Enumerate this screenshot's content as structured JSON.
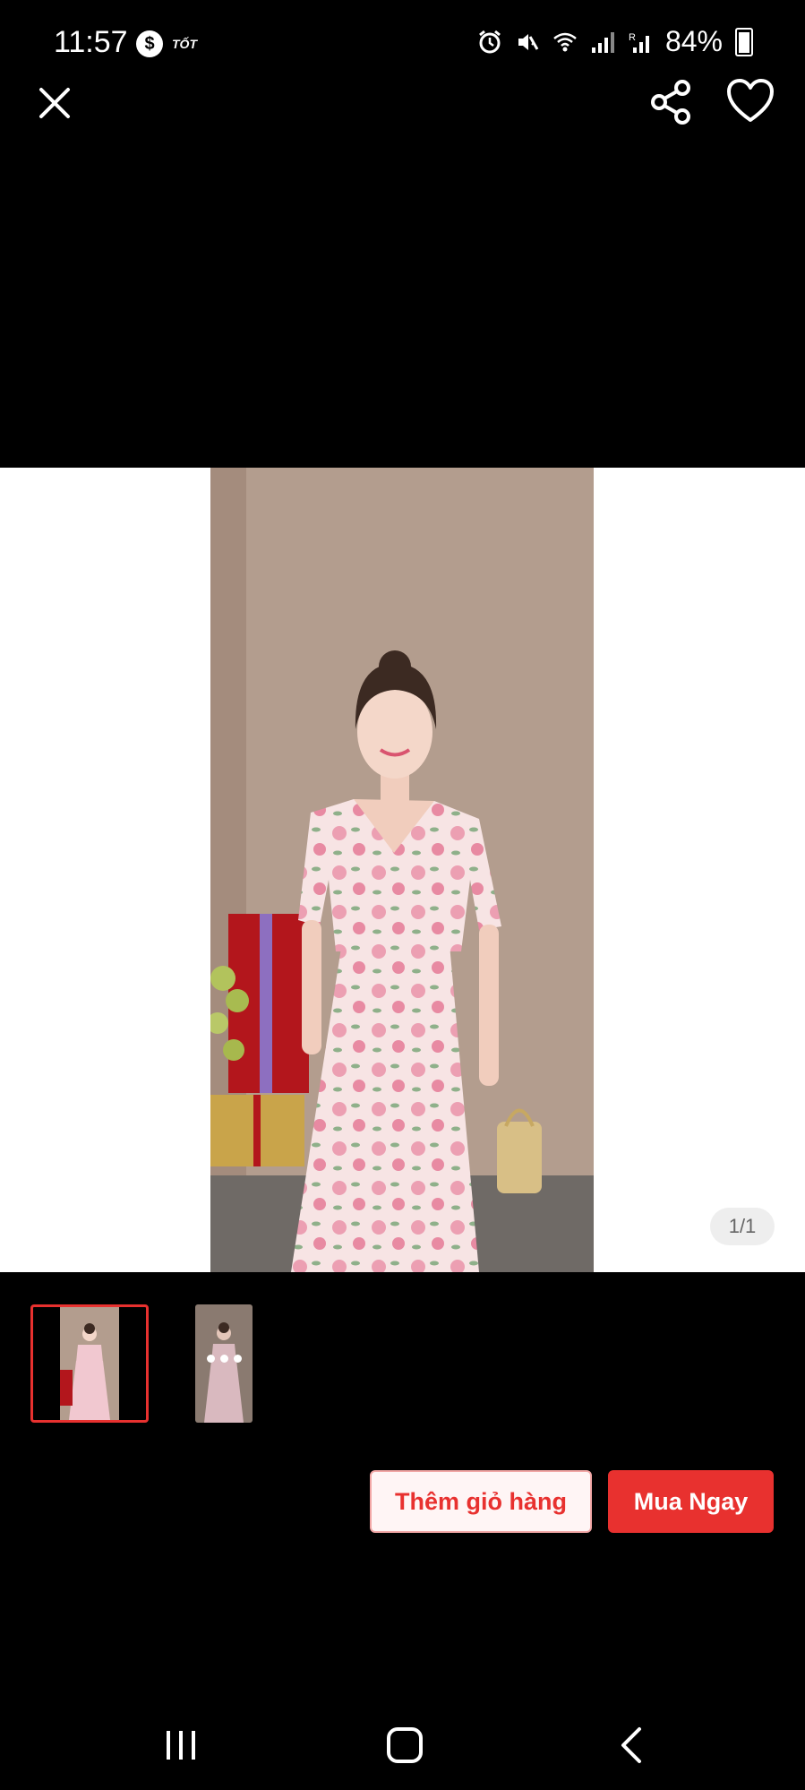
{
  "status_bar": {
    "time": "11:57",
    "app_badge_text": "TỐT",
    "battery_percent": "84%"
  },
  "top_bar": {
    "close_icon": "close-icon",
    "share_icon": "share-icon",
    "favorite_icon": "heart-icon"
  },
  "gallery": {
    "page_counter": "1/1",
    "thumbnail_count": 2,
    "selected_thumbnail": 1
  },
  "actions": {
    "add_to_cart_label": "Thêm giỏ hàng",
    "buy_now_label": "Mua Ngay"
  },
  "colors": {
    "accent": "#e8312f",
    "background": "#000000"
  }
}
